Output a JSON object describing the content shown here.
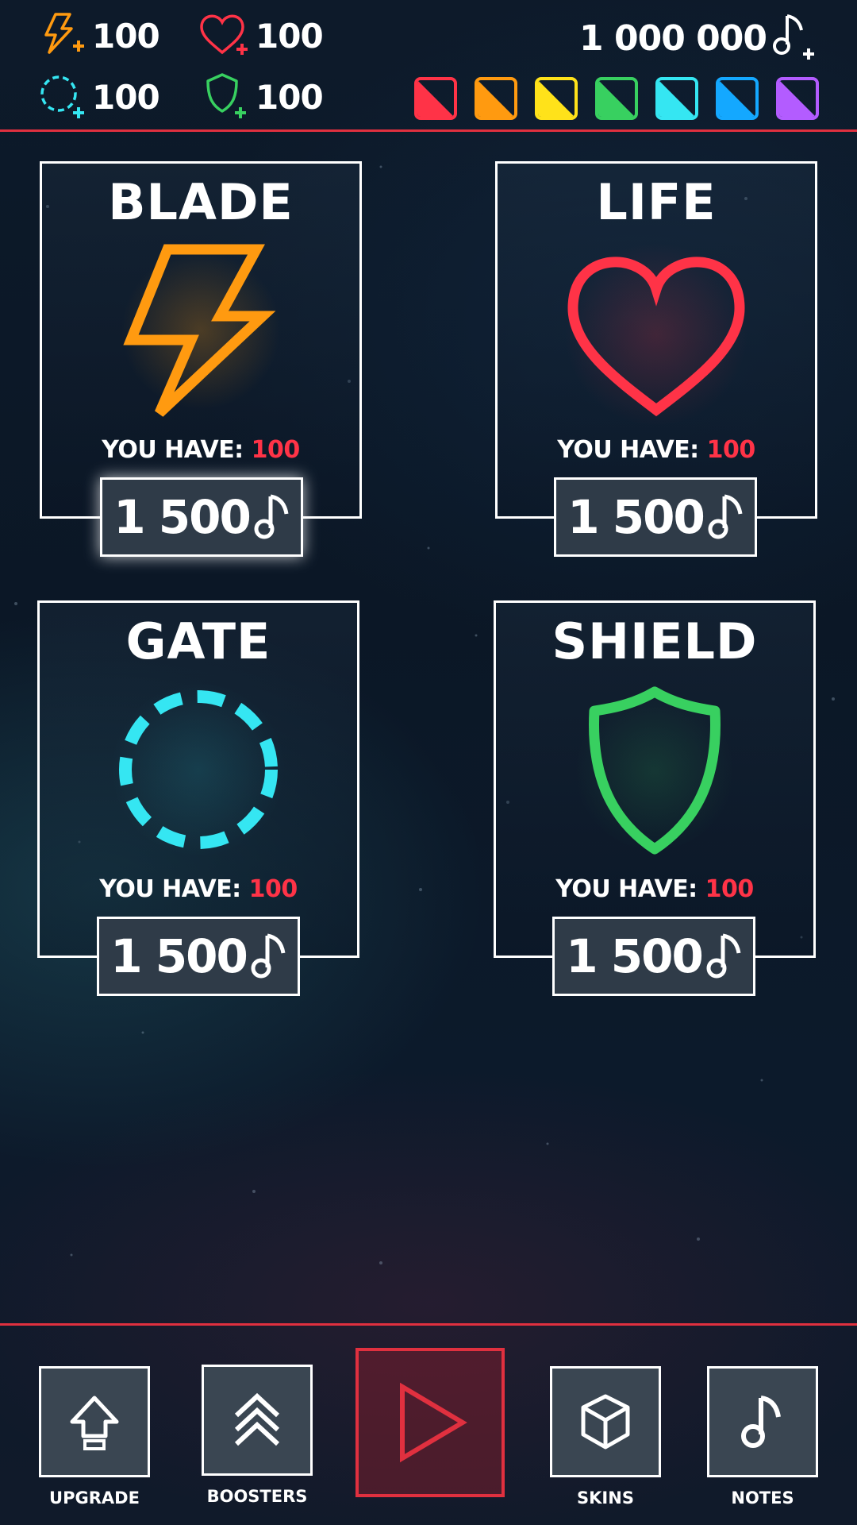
{
  "resources": {
    "blade": {
      "value": "100",
      "icon": "lightning-plus-icon",
      "color": "#ff9a10"
    },
    "life": {
      "value": "100",
      "icon": "heart-plus-icon",
      "color": "#ff3347"
    },
    "gate": {
      "value": "100",
      "icon": "dashed-circle-plus-icon",
      "color": "#35e6f2"
    },
    "shield": {
      "value": "100",
      "icon": "shield-plus-icon",
      "color": "#38d060"
    }
  },
  "wallet": {
    "value": "1 000 000",
    "icon": "music-note-plus-icon"
  },
  "gems": [
    "#ff3347",
    "#ff9a10",
    "#ffe21a",
    "#38d060",
    "#35e6f2",
    "#14a8ff",
    "#b35cff"
  ],
  "boosters": [
    {
      "title": "BLADE",
      "have_label": "YOU HAVE:",
      "have_value": "100",
      "price": "1 500",
      "color": "#ff9a10"
    },
    {
      "title": "LIFE",
      "have_label": "YOU HAVE:",
      "have_value": "100",
      "price": "1 500",
      "color": "#ff3347"
    },
    {
      "title": "GATE",
      "have_label": "YOU HAVE:",
      "have_value": "100",
      "price": "1 500",
      "color": "#35e6f2"
    },
    {
      "title": "SHIELD",
      "have_label": "YOU HAVE:",
      "have_value": "100",
      "price": "1 500",
      "color": "#38d060"
    }
  ],
  "nav": {
    "upgrade": "UPGRADE",
    "boosters": "BOOSTERS",
    "skins": "SKINS",
    "notes": "NOTES"
  },
  "colors": {
    "accent": "#e0303f",
    "highlight": "#ff3347"
  }
}
